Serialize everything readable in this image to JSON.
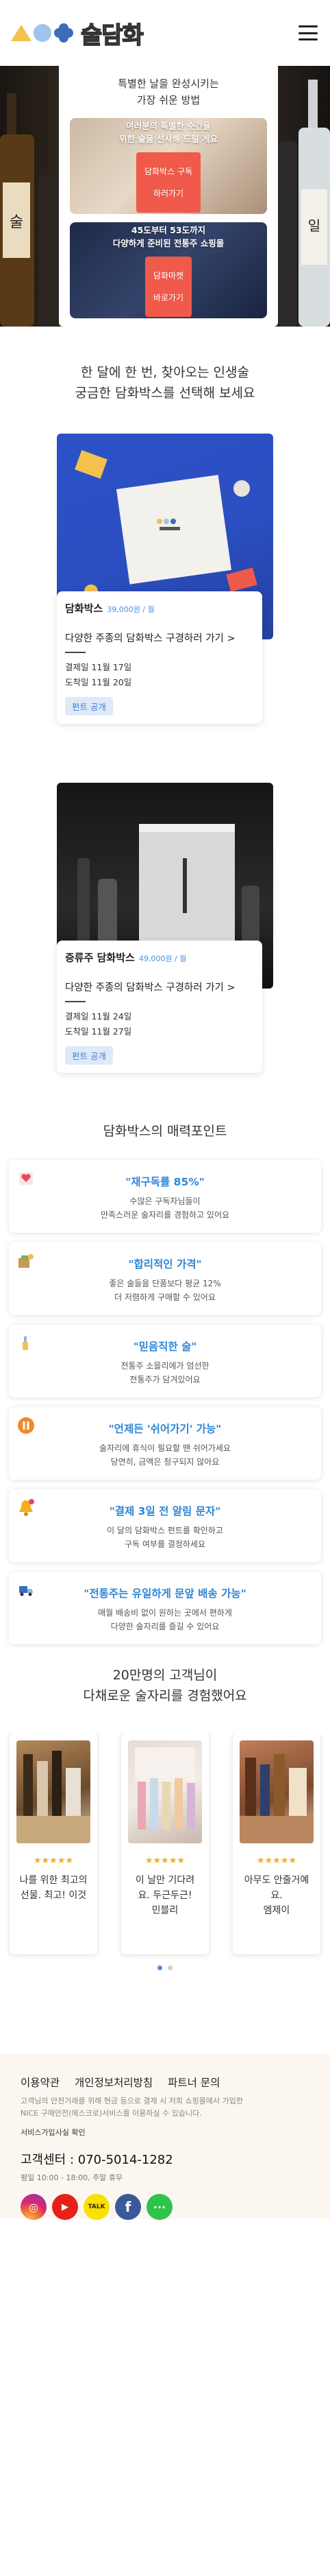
{
  "header": {
    "logo_text": "술담화",
    "menu_icon": "hamburger-icon"
  },
  "hero": {
    "title_line1": "특별한 날을 완성시키는",
    "title_line2": "가장 쉬운 방법",
    "promo1": {
      "text_line1": "여러분의 특별한 순간을",
      "text_line2": "위한 술을 선사해 드릴 게요",
      "button_line1": "담화박스 구독",
      "button_line2": "하러가기"
    },
    "promo2": {
      "text_line1": "45도부터 53도까지",
      "text_line2": "다양하게 준비된 전통주 쇼핑몰",
      "button_line1": "담화마켓",
      "button_line2": "바로가기"
    }
  },
  "intro": {
    "line1": "한 달에 한 번, 찾아오는 인생술",
    "line2": "궁금한 담화박스를 선택해 보세요"
  },
  "products": [
    {
      "name": "담화박스",
      "price": "39,000원 / 월",
      "link": "다양한 주종의 담화박스 구경하러 가기 >",
      "pay_date": "결제일 11월 17일",
      "arrival_date": "도착일 11월 20일",
      "tag": "펀트 공개"
    },
    {
      "name": "증류주 담화박스",
      "price": "49,000원 / 월",
      "link": "다양한 주종의 담화박스 구경하러 가기 >",
      "pay_date": "결제일 11월 24일",
      "arrival_date": "도착일 11월 27일",
      "tag": "펀트 공개"
    }
  ],
  "features": {
    "title": "담화박스의 매력포인트",
    "items": [
      {
        "icon": "heart-icon",
        "title": "\"재구독률 85%\"",
        "desc": "수많은 구독자님들이\n만족스러운 술자리를 경험하고 있어요"
      },
      {
        "icon": "price-tag-icon",
        "title": "\"합리적인 가격\"",
        "desc": "좋은 술들을 단품보다 평균 12%\n더 저렴하게 구매할 수 있어요"
      },
      {
        "icon": "sommelier-icon",
        "title": "\"믿음직한 술\"",
        "desc": "전통주 소믈리에가 엄선한\n전통주가 담겨있어요"
      },
      {
        "icon": "pause-icon",
        "title": "\"언제든 '쉬어가기' 가능\"",
        "desc": "술자리에 휴식이 필요할 땐 쉬어가세요\n당연히, 금액은 청구되지 않아요"
      },
      {
        "icon": "bell-icon",
        "title": "\"결제 3일 전 알림 문자\"",
        "desc": "이 달의 담화박스 펀트를 확인하고\n구독 여부를 결정하세요"
      },
      {
        "icon": "delivery-icon",
        "title": "\"전통주는 유일하게 문앞 배송 가능\"",
        "desc": "매월 배송비 없이 원하는 곳에서 편하게\n다양한 술자리를 즐길 수 있어요"
      }
    ]
  },
  "reviews": {
    "title_line1": "20만명의 고객님이",
    "title_line2": "다채로운 술자리를 경험했어요",
    "items": [
      {
        "stars": "★★★★★",
        "line1": "나를 위한 최고의",
        "line2": "선물. 최고! 이것"
      },
      {
        "stars": "★★★★★",
        "line1": "이 날만 기다려",
        "line2": "요. 두근두근!",
        "line3": "민블리"
      },
      {
        "stars": "★★★★★",
        "line1": "아무도 안줄거예",
        "line2": "요.",
        "line3": "엠제이"
      }
    ]
  },
  "footer": {
    "links": [
      "이용약관",
      "개인정보처리방침",
      "파트너 문의"
    ],
    "desc_line1": "고객님의 안전거래를 위해 현금 등으로 결제 시 저희 쇼핑몰에서 가입한",
    "desc_line2": "NICE 구매안전(에스크로)서비스를 이용하실 수 있습니다.",
    "verify": "서비스가입사실 확인",
    "cs": "고객센터 : 070-5014-1282",
    "hours": "평일 10:00 - 18:00, 주말 휴무",
    "sns": [
      {
        "icon": "instagram-icon",
        "glyph": "◎"
      },
      {
        "icon": "youtube-icon",
        "glyph": "▶"
      },
      {
        "icon": "kakaotalk-icon",
        "glyph": "TALK"
      },
      {
        "icon": "facebook-icon",
        "glyph": "f"
      },
      {
        "icon": "channel-icon",
        "glyph": "···"
      }
    ]
  },
  "colors": {
    "accent_blue": "#2f86d6",
    "promo_button": "#ef5a4a",
    "star": "#f2b01e",
    "footer_bg": "#fbf7f0"
  }
}
